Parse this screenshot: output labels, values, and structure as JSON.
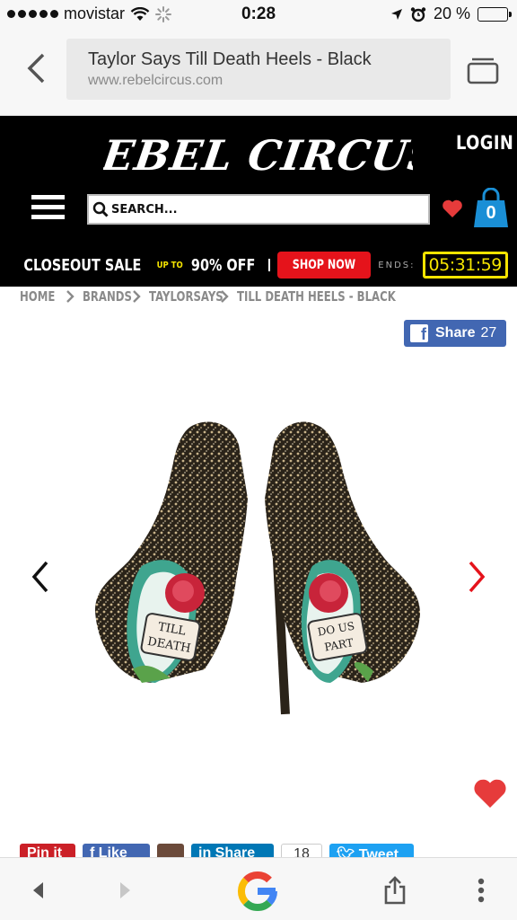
{
  "status_bar": {
    "carrier": "movistar",
    "time": "0:28",
    "battery": "20 %",
    "battery_level": 0.2
  },
  "browser": {
    "page_title": "Taylor Says Till Death Heels - Black",
    "domain": "www.rebelcircus.com"
  },
  "header": {
    "logo_text": "REBEL CIRCUS",
    "login_label": "LOGIN",
    "search_placeholder": "SEARCH...",
    "cart_count": "0",
    "promo": {
      "part1": "CLOSEOUT SALE",
      "up_to": "UP TO",
      "percent": "90% OFF",
      "shop_now": "SHOP NOW",
      "ends_label": "ENDS:",
      "countdown": "05:31:59"
    }
  },
  "breadcrumb": [
    {
      "label": "HOME"
    },
    {
      "label": "BRANDS"
    },
    {
      "label": "TAYLORSAYS"
    },
    {
      "label": "TILL DEATH HEELS - BLACK"
    }
  ],
  "fb_share": {
    "label": "Share",
    "count": "27"
  },
  "product_image": {
    "sole_text_left": [
      "TILL",
      "DEATH"
    ],
    "sole_text_right": [
      "DO US",
      "PART"
    ]
  },
  "social": {
    "pin_label": "Pin it",
    "like_label": "Like",
    "share_label": "Share",
    "share_count": "18",
    "tweet_label": "Tweet"
  },
  "colors": {
    "header_bg": "#000000",
    "accent_red": "#e5131b",
    "timer_yellow": "#f5e400",
    "cart_blue": "#1a8fd6",
    "facebook_blue": "#4267b2"
  }
}
